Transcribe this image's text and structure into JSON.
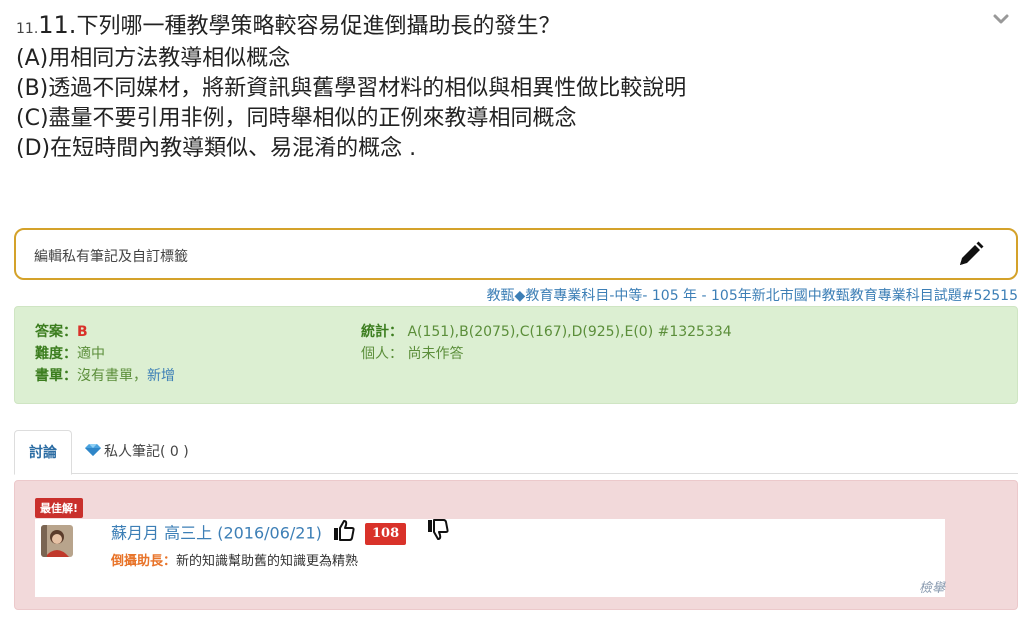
{
  "question": {
    "num_small": "11.",
    "num_big": "11.",
    "stem": "下列哪一種教學策略較容易促進倒攝助長的發生？",
    "options": [
      "(A)用相同方法教導相似概念",
      "(B)透過不同媒材，將新資訊與舊學習材料的相似與相異性做比較說明",
      "(C)盡量不要引用非例，同時舉相似的正例來教導相同概念",
      "(D)在短時間內教導類似、易混淆的概念 ."
    ]
  },
  "notes": {
    "label": "編輯私有筆記及自訂標籤"
  },
  "source": "教甄◆教育專業科目-中等- 105 年 - 105年新北市國中教甄教育專業科目試題#52515",
  "answer_panel": {
    "answer_key": "答案：",
    "answer_value": "B",
    "difficulty_key": "難度：",
    "difficulty_value": "適中",
    "booklist_key": "書單：",
    "booklist_value": "沒有書單，",
    "booklist_add": "新增",
    "stats_key": "統計：",
    "stats_value": "A(151),B(2075),C(167),D(925),E(0) #1325334",
    "personal_key": "個人：",
    "personal_value": "尚未作答"
  },
  "tabs": {
    "discussion": "討論",
    "private_notes": "私人筆記( 0 )"
  },
  "best_answer": {
    "badge": "最佳解!",
    "author": "蘇月月",
    "grade_time": "高三上 (2016/06/21)",
    "likes": "108",
    "term": "倒攝助長：",
    "body": "新的知識幫助舊的知識更為精熟",
    "report": "檢舉"
  }
}
